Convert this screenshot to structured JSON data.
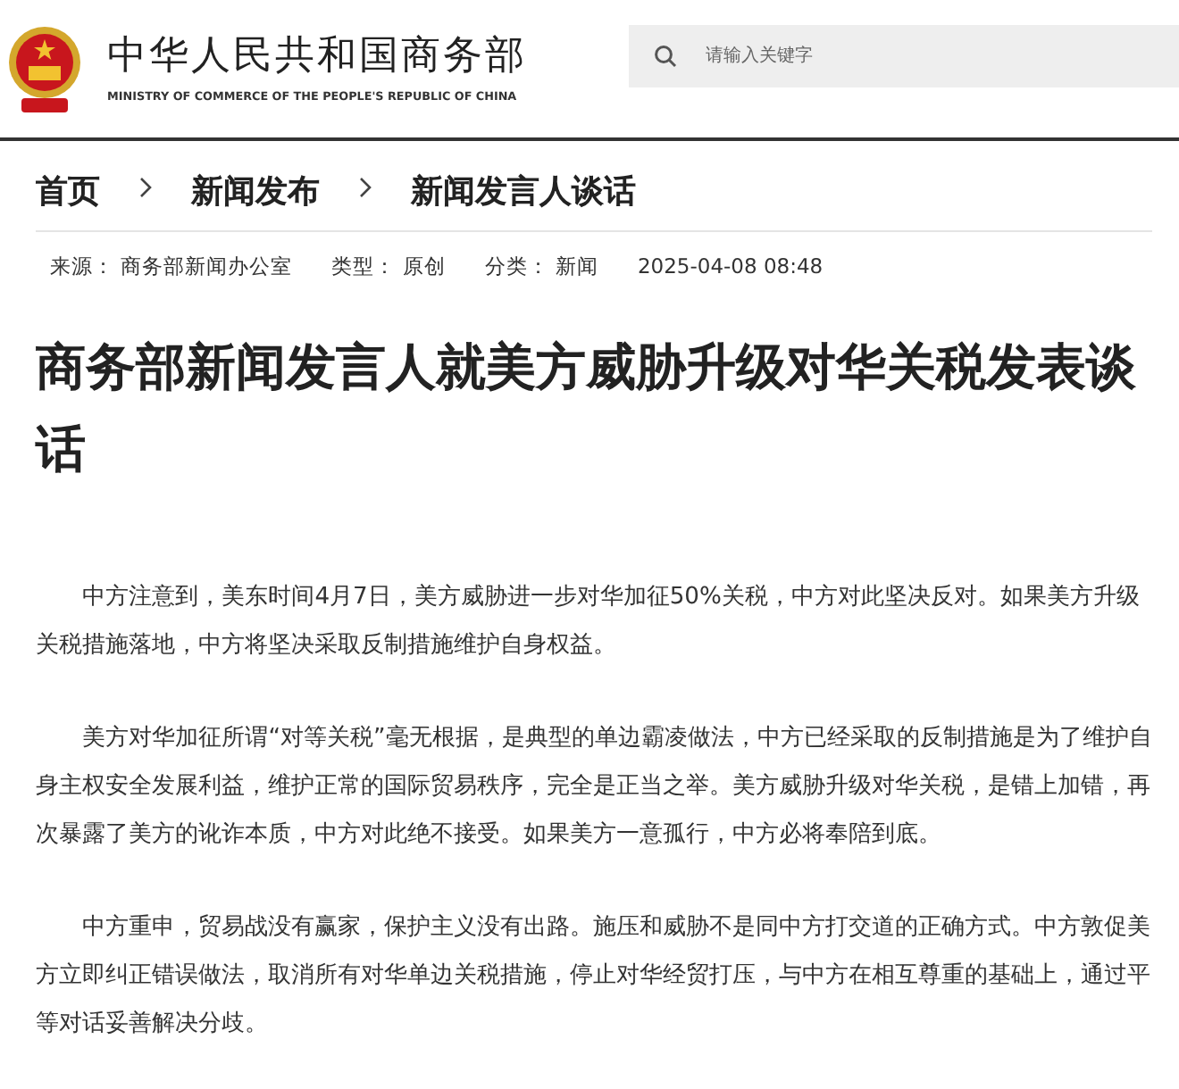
{
  "header": {
    "title": "中华人民共和国商务部",
    "subtitle": "MINISTRY OF COMMERCE OF THE PEOPLE'S REPUBLIC OF CHINA",
    "search": {
      "placeholder": "请输入关键字"
    }
  },
  "breadcrumb": [
    "首页",
    "新闻发布",
    "新闻发言人谈话"
  ],
  "meta": [
    {
      "label": "来源：",
      "value": "商务部新闻办公室"
    },
    {
      "label": "类型：",
      "value": "原创"
    },
    {
      "label": "分类：",
      "value": "新闻"
    },
    {
      "value": "2025-04-08 08:48"
    }
  ],
  "article": {
    "title": "商务部新闻发言人就美方威胁升级对华关税发表谈话",
    "paragraphs": [
      "中方注意到，美东时间4月7日，美方威胁进一步对华加征50%关税，中方对此坚决反对。如果美方升级关税措施落地，中方将坚决采取反制措施维护自身权益。",
      "美方对华加征所谓“对等关税”毫无根据，是典型的单边霸凌做法，中方已经采取的反制措施是为了维护自身主权安全发展利益，维护正常的国际贸易秩序，完全是正当之举。美方威胁升级对华关税，是错上加错，再次暴露了美方的讹诈本质，中方对此绝不接受。如果美方一意孤行，中方必将奉陪到底。",
      "中方重申，贸易战没有赢家，保护主义没有出路。施压和威胁不是同中方打交道的正确方式。中方敦促美方立即纠正错误做法，取消所有对华单边关税措施，停止对华经贸打压，与中方在相互尊重的基础上，通过平等对话妥善解决分歧。"
    ]
  }
}
